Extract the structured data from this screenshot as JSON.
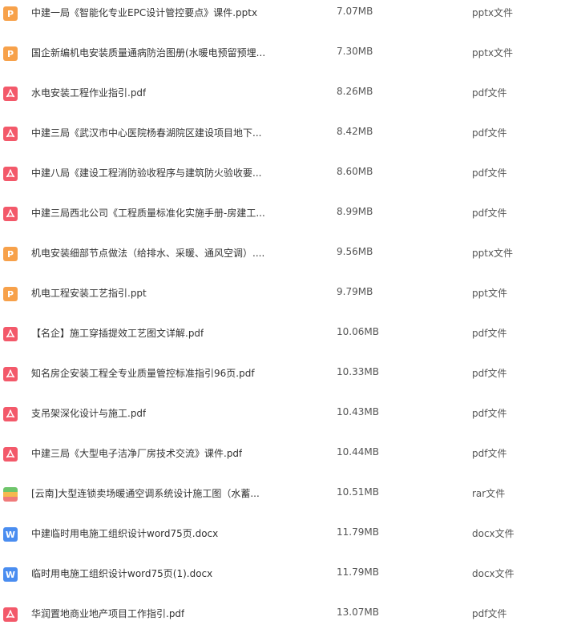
{
  "files": [
    {
      "name": "中建一局《智能化专业EPC设计管控要点》课件.pptx",
      "size": "7.07MB",
      "type": "pptx文件",
      "icon": "ppt-icon"
    },
    {
      "name": "国企新编机电安装质量通病防治图册(水暖电预留预埋...",
      "size": "7.30MB",
      "type": "pptx文件",
      "icon": "ppt-icon"
    },
    {
      "name": "水电安装工程作业指引.pdf",
      "size": "8.26MB",
      "type": "pdf文件",
      "icon": "pdf-icon"
    },
    {
      "name": "中建三局《武汉市中心医院杨春湖院区建设项目地下...",
      "size": "8.42MB",
      "type": "pdf文件",
      "icon": "pdf-icon"
    },
    {
      "name": "中建八局《建设工程消防验收程序与建筑防火验收要...",
      "size": "8.60MB",
      "type": "pdf文件",
      "icon": "pdf-icon"
    },
    {
      "name": "中建三局西北公司《工程质量标准化实施手册-房建工...",
      "size": "8.99MB",
      "type": "pdf文件",
      "icon": "pdf-icon"
    },
    {
      "name": "机电安装细部节点做法（给排水、采暖、通风空调）....",
      "size": "9.56MB",
      "type": "pptx文件",
      "icon": "ppt-icon"
    },
    {
      "name": "机电工程安装工艺指引.ppt",
      "size": "9.79MB",
      "type": "ppt文件",
      "icon": "ppt-icon"
    },
    {
      "name": "【名企】施工穿插提效工艺图文详解.pdf",
      "size": "10.06MB",
      "type": "pdf文件",
      "icon": "pdf-icon"
    },
    {
      "name": "知名房企安装工程全专业质量管控标准指引96页.pdf",
      "size": "10.33MB",
      "type": "pdf文件",
      "icon": "pdf-icon"
    },
    {
      "name": "支吊架深化设计与施工.pdf",
      "size": "10.43MB",
      "type": "pdf文件",
      "icon": "pdf-icon"
    },
    {
      "name": "中建三局《大型电子洁净厂房技术交流》课件.pdf",
      "size": "10.44MB",
      "type": "pdf文件",
      "icon": "pdf-icon"
    },
    {
      "name": "[云南]大型连锁卖场暖通空调系统设计施工图（水蓄...",
      "size": "10.51MB",
      "type": "rar文件",
      "icon": "rar-icon"
    },
    {
      "name": "中建临时用电施工组织设计word75页.docx",
      "size": "11.79MB",
      "type": "docx文件",
      "icon": "word-icon"
    },
    {
      "name": "临时用电施工组织设计word75页(1).docx",
      "size": "11.79MB",
      "type": "docx文件",
      "icon": "word-icon"
    },
    {
      "name": "华润置地商业地产项目工作指引.pdf",
      "size": "13.07MB",
      "type": "pdf文件",
      "icon": "pdf-icon"
    }
  ],
  "colors": {
    "pdf": "#f3596a",
    "ppt": "#f7a14a",
    "word": "#4a8df0"
  }
}
